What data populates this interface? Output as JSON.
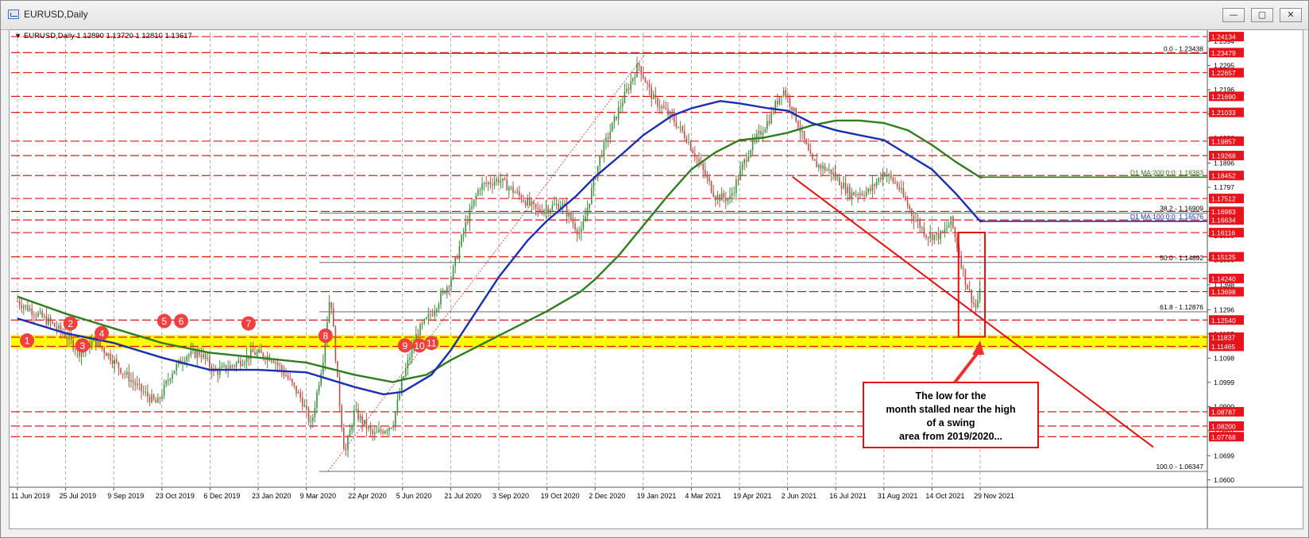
{
  "window": {
    "title": "EURUSD,Daily",
    "buttons": {
      "minimize": "—",
      "maximize": "▢",
      "close": "✕"
    }
  },
  "chart_data": {
    "type": "line",
    "symbol_header": {
      "arrow": "▼",
      "text": "EURUSD,Daily  1.12890 1.13720 1.12810 1.13617"
    },
    "ylim": [
      1.057,
      1.243
    ],
    "x_ticks": [
      "11 Jun 2019",
      "25 Jul 2019",
      "9 Sep 2019",
      "23 Oct 2019",
      "6 Dec 2019",
      "23 Jan 2020",
      "9 Mar 2020",
      "22 Apr 2020",
      "5 Jun 2020",
      "21 Jul 2020",
      "3 Sep 2020",
      "19 Oct 2020",
      "2 Dec 2020",
      "19 Jan 2021",
      "4 Mar 2021",
      "19 Apr 2021",
      "2 Jun 2021",
      "16 Jul 2021",
      "31 Aug 2021",
      "14 Oct 2021",
      "29 Nov 2021"
    ],
    "price_axis_ticks": [
      1.2394,
      1.2295,
      1.2196,
      1.2097,
      1.1998,
      1.1896,
      1.1797,
      1.1698,
      1.1599,
      1.15,
      1.1398,
      1.1296,
      1.1197,
      1.1098,
      1.0999,
      1.09,
      1.0801,
      1.0699,
      1.06
    ],
    "red_levels": [
      1.24134,
      1.23479,
      1.22657,
      1.2169,
      1.21033,
      1.19857,
      1.19268,
      1.18452,
      1.17512,
      1.16983,
      1.16634,
      1.16116,
      1.15125,
      1.1424,
      1.13698,
      1.1254,
      1.11837,
      1.11465,
      1.08787,
      1.082,
      1.07768
    ],
    "support_zone": [
      1.11465,
      1.11837
    ],
    "fibonacci": [
      {
        "label": "0.0 - 1.23438",
        "value": 1.23438
      },
      {
        "label": "38.2 - 1.16909",
        "value": 1.16909
      },
      {
        "label": "50.0 - 1.14892",
        "value": 1.14892
      },
      {
        "label": "61.8 - 1.12876",
        "value": 1.12876
      },
      {
        "label": "100.0 - 1.06347",
        "value": 1.06347
      }
    ],
    "moving_averages": [
      {
        "name": "D1 MA:200:0:0: 1.18383",
        "label_text": "D1 MA:200:0:0: 1.18383",
        "color": "#2e7d1e",
        "value": 1.18383
      },
      {
        "name": "D1 MA:100:0:0: 1.16576",
        "label_text": "D1 MA:100:0:0: 1.16576",
        "color": "#1a2fb0",
        "value": 1.16576
      }
    ],
    "swing_markers": [
      "1",
      "2",
      "3",
      "4",
      "5",
      "6",
      "7",
      "8",
      "9",
      "10",
      "11"
    ],
    "annotation": "The low for the month stalled near the high of a swing area from 2019/2020...",
    "colors": {
      "level_line": "#d40000",
      "label_bg": "#e8141b",
      "support_zone": "#ffff00",
      "up_candle": "#3f8f3f",
      "down_candle": "#c0504d",
      "trendline": "#e01010",
      "marker": "#f04040"
    }
  }
}
